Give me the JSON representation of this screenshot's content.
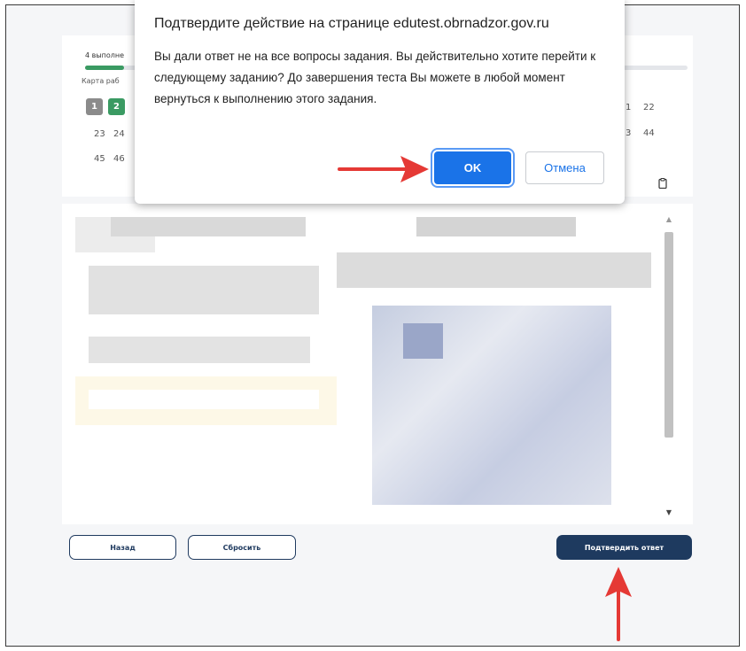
{
  "dialog": {
    "title": "Подтвердите действие на странице edutest.obrnadzor.gov.ru",
    "message": "Вы дали ответ не на все вопросы задания. Вы действительно хотите перейти к следующему заданию? До завершения теста Вы можете в любой момент вернуться к выполнению этого задания.",
    "ok_label": "OK",
    "cancel_label": "Отмена"
  },
  "task_panel": {
    "progress_text": "4 выполне",
    "progress_fraction": 0.065,
    "map_title": "Карта раб",
    "tiles": [
      {
        "label": "1",
        "state": "done"
      },
      {
        "label": "2",
        "state": "current"
      }
    ],
    "numbers_row2": [
      "23",
      "24"
    ],
    "numbers_row3": [
      "45",
      "46"
    ],
    "numbers_right_row1": [
      "1",
      "22"
    ],
    "numbers_right_row2": [
      "3",
      "44"
    ]
  },
  "buttons": {
    "back_label": "Назад",
    "reset_label": "Сбросить",
    "confirm_label": "Подтвердить ответ"
  },
  "colors": {
    "accent_green": "#3a9a62",
    "primary_blue": "#1e3a5f",
    "dialog_button": "#1a73e8",
    "annotation_arrow": "#e53935"
  }
}
